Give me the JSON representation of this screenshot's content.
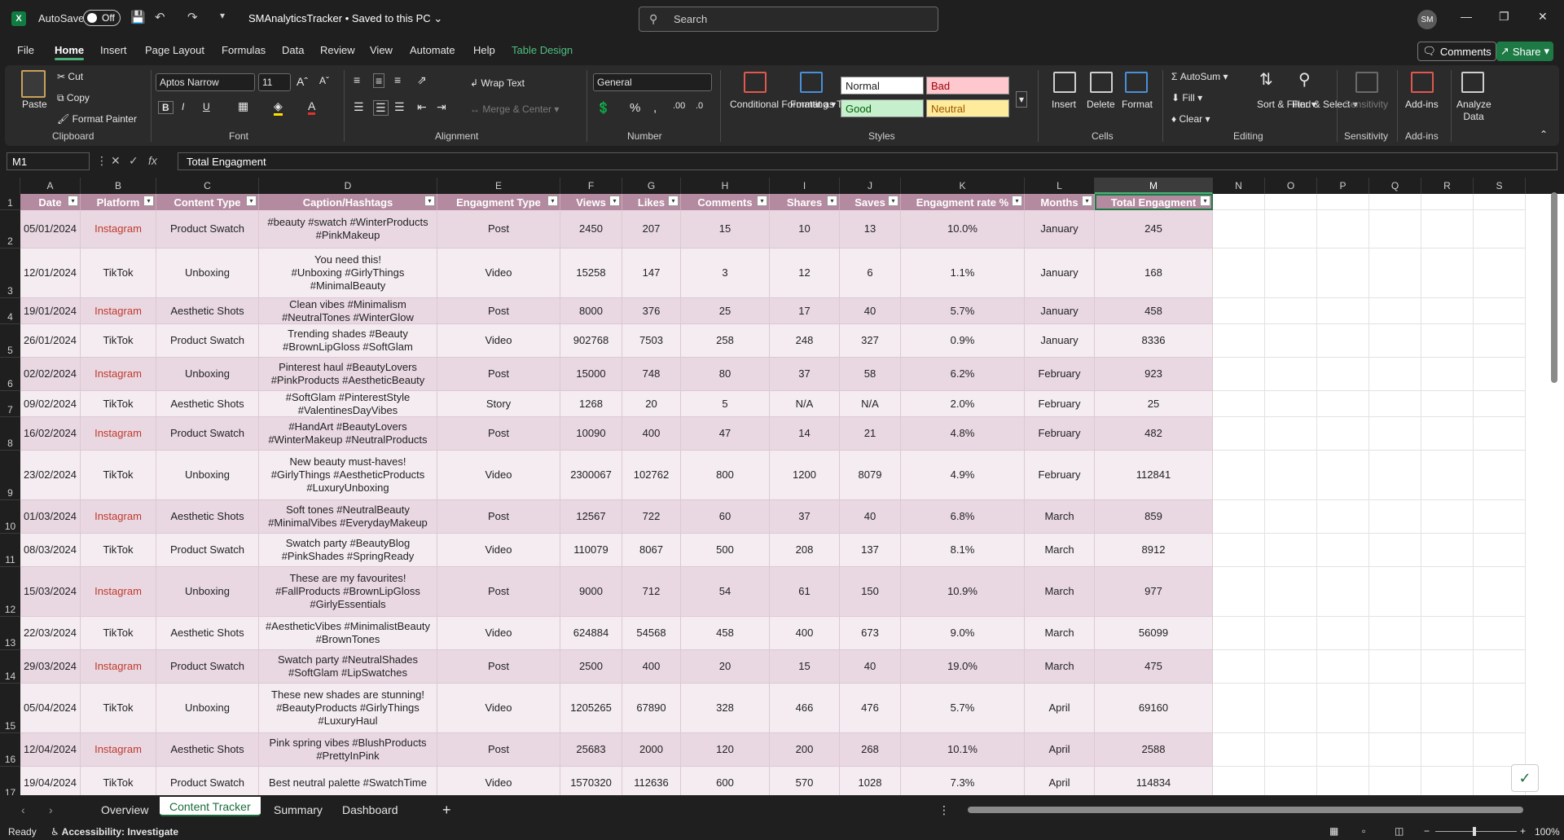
{
  "title_bar": {
    "app_icon": "X",
    "autosave_label": "AutoSave",
    "autosave_state": "Off",
    "filename": "SMAnalyticsTracker • Saved to this PC",
    "search_placeholder": "Search",
    "avatar_initials": "SM"
  },
  "menu": {
    "items": [
      "File",
      "Home",
      "Insert",
      "Page Layout",
      "Formulas",
      "Data",
      "Review",
      "View",
      "Automate",
      "Help",
      "Table Design"
    ],
    "active": "Home",
    "comments_label": "Comments",
    "share_label": "Share"
  },
  "ribbon": {
    "clipboard": {
      "paste": "Paste",
      "cut": "Cut",
      "copy": "Copy",
      "format_painter": "Format Painter",
      "label": "Clipboard"
    },
    "font": {
      "family": "Aptos Narrow",
      "size": "11",
      "label": "Font"
    },
    "alignment": {
      "wrap_text": "Wrap Text",
      "merge_center": "Merge & Center",
      "label": "Alignment"
    },
    "number": {
      "format": "General",
      "label": "Number"
    },
    "styles": {
      "conditional": "Conditional Formatting",
      "format_table": "Format as Table",
      "normal": "Normal",
      "bad": "Bad",
      "good": "Good",
      "neutral": "Neutral",
      "label": "Styles"
    },
    "cells": {
      "insert": "Insert",
      "delete": "Delete",
      "format": "Format",
      "label": "Cells"
    },
    "editing": {
      "autosum": "AutoSum",
      "fill": "Fill",
      "clear": "Clear",
      "sort_filter": "Sort & Filter",
      "find_select": "Find & Select",
      "label": "Editing"
    },
    "sensitivity": {
      "button": "Sensitivity",
      "label": "Sensitivity"
    },
    "addins": {
      "button": "Add-ins",
      "label": "Add-ins"
    },
    "analyze": {
      "button": "Analyze Data"
    }
  },
  "formula_bar": {
    "name_box": "M1",
    "fx": "fx",
    "content": "Total Engagment"
  },
  "columns": [
    "A",
    "B",
    "C",
    "D",
    "E",
    "F",
    "G",
    "H",
    "I",
    "J",
    "K",
    "L",
    "M",
    "N",
    "O",
    "P",
    "Q",
    "R",
    "S"
  ],
  "table_headers": [
    "Date",
    "Platform",
    "Content Type",
    "Caption/Hashtags",
    "Engagment Type",
    "Views",
    "Likes",
    "Comments",
    "Shares",
    "Saves",
    "Engagment rate %",
    "Months",
    "Total Engagment"
  ],
  "rows": [
    {
      "n": "2",
      "cells": [
        "05/01/2024",
        "Instagram",
        "Product Swatch",
        "#beauty #swatch #WinterProducts\n#PinkMakeup",
        "Post",
        "2450",
        "207",
        "15",
        "10",
        "13",
        "10.0%",
        "January",
        "245"
      ]
    },
    {
      "n": "3",
      "cells": [
        "12/01/2024",
        "TikTok",
        "Unboxing",
        "You need this!\n#Unboxing #GirlyThings\n#MinimalBeauty",
        "Video",
        "15258",
        "147",
        "3",
        "12",
        "6",
        "1.1%",
        "January",
        "168"
      ]
    },
    {
      "n": "4",
      "cells": [
        "19/01/2024",
        "Instagram",
        "Aesthetic Shots",
        "Clean vibes #Minimalism\n#NeutralTones #WinterGlow",
        "Post",
        "8000",
        "376",
        "25",
        "17",
        "40",
        "5.7%",
        "January",
        "458"
      ]
    },
    {
      "n": "5",
      "cells": [
        "26/01/2024",
        "TikTok",
        "Product Swatch",
        "Trending shades #Beauty\n#BrownLipGloss #SoftGlam",
        "Video",
        "902768",
        "7503",
        "258",
        "248",
        "327",
        "0.9%",
        "January",
        "8336"
      ]
    },
    {
      "n": "6",
      "cells": [
        "02/02/2024",
        "Instagram",
        "Unboxing",
        "Pinterest haul #BeautyLovers\n#PinkProducts #AestheticBeauty",
        "Post",
        "15000",
        "748",
        "80",
        "37",
        "58",
        "6.2%",
        "February",
        "923"
      ]
    },
    {
      "n": "7",
      "cells": [
        "09/02/2024",
        "TikTok",
        "Aesthetic Shots",
        "#SoftGlam #PinterestStyle\n#ValentinesDayVibes",
        "Story",
        "1268",
        "20",
        "5",
        "N/A",
        "N/A",
        "2.0%",
        "February",
        "25"
      ]
    },
    {
      "n": "8",
      "cells": [
        "16/02/2024",
        "Instagram",
        "Product Swatch",
        "#HandArt #BeautyLovers\n#WinterMakeup #NeutralProducts",
        "Post",
        "10090",
        "400",
        "47",
        "14",
        "21",
        "4.8%",
        "February",
        "482"
      ]
    },
    {
      "n": "9",
      "cells": [
        "23/02/2024",
        "TikTok",
        "Unboxing",
        "New beauty must-haves!\n#GirlyThings #AestheticProducts\n#LuxuryUnboxing",
        "Video",
        "2300067",
        "102762",
        "800",
        "1200",
        "8079",
        "4.9%",
        "February",
        "112841"
      ]
    },
    {
      "n": "10",
      "cells": [
        "01/03/2024",
        "Instagram",
        "Aesthetic Shots",
        "Soft tones #NeutralBeauty\n#MinimalVibes #EverydayMakeup",
        "Post",
        "12567",
        "722",
        "60",
        "37",
        "40",
        "6.8%",
        "March",
        "859"
      ]
    },
    {
      "n": "11",
      "cells": [
        "08/03/2024",
        "TikTok",
        "Product Swatch",
        "Swatch party #BeautyBlog\n#PinkShades #SpringReady",
        "Video",
        "110079",
        "8067",
        "500",
        "208",
        "137",
        "8.1%",
        "March",
        "8912"
      ]
    },
    {
      "n": "12",
      "cells": [
        "15/03/2024",
        "Instagram",
        "Unboxing",
        "These are my favourites!\n#FallProducts #BrownLipGloss\n#GirlyEssentials",
        "Post",
        "9000",
        "712",
        "54",
        "61",
        "150",
        "10.9%",
        "March",
        "977"
      ]
    },
    {
      "n": "13",
      "cells": [
        "22/03/2024",
        "TikTok",
        "Aesthetic Shots",
        "#AestheticVibes #MinimalistBeauty\n#BrownTones",
        "Video",
        "624884",
        "54568",
        "458",
        "400",
        "673",
        "9.0%",
        "March",
        "56099"
      ]
    },
    {
      "n": "14",
      "cells": [
        "29/03/2024",
        "Instagram",
        "Product Swatch",
        "Swatch party #NeutralShades\n#SoftGlam #LipSwatches",
        "Post",
        "2500",
        "400",
        "20",
        "15",
        "40",
        "19.0%",
        "March",
        "475"
      ]
    },
    {
      "n": "15",
      "cells": [
        "05/04/2024",
        "TikTok",
        "Unboxing",
        "These new shades are stunning!\n#BeautyProducts #GirlyThings\n#LuxuryHaul",
        "Video",
        "1205265",
        "67890",
        "328",
        "466",
        "476",
        "5.7%",
        "April",
        "69160"
      ]
    },
    {
      "n": "16",
      "cells": [
        "12/04/2024",
        "Instagram",
        "Aesthetic Shots",
        "Pink spring vibes #BlushProducts\n#PrettyInPink",
        "Post",
        "25683",
        "2000",
        "120",
        "200",
        "268",
        "10.1%",
        "April",
        "2588"
      ]
    },
    {
      "n": "17",
      "cells": [
        "19/04/2024",
        "TikTok",
        "Product Swatch",
        "Best neutral palette #SwatchTime",
        "Video",
        "1570320",
        "112636",
        "600",
        "570",
        "1028",
        "7.3%",
        "April",
        "114834"
      ]
    }
  ],
  "sheets": [
    "Overview",
    "Content Tracker",
    "Summary",
    "Dashboard"
  ],
  "active_sheet": "Content Tracker",
  "status": {
    "ready": "Ready",
    "accessibility": "Accessibility: Investigate",
    "zoom": "100%"
  },
  "colors": {
    "header_pink": "#b48aa0",
    "row_pink": "#e9d8e2",
    "row_light": "#f4ecf1",
    "instagram_red": "#c0392b",
    "accent_green": "#1d7a45"
  }
}
